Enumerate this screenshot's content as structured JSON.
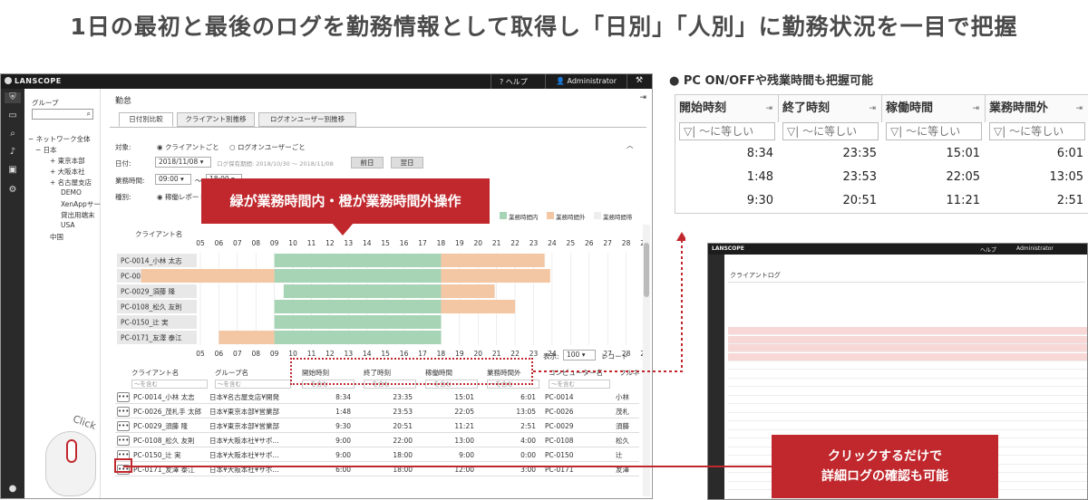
{
  "headline": "1日の最初と最後のログを勤務情報として取得し「日別」「人別」に勤務状況を一目で把握",
  "app": {
    "brand": "LANSCOPE",
    "help": "ヘルプ",
    "admin": "Administrator",
    "sidebar": {
      "group_label": "グループ",
      "tree": [
        "ネットワーク全体",
        "日本",
        "東京本部",
        "大阪本社",
        "名古屋支店",
        "DEMO",
        "XenAppサー.",
        "貸出用端末",
        "USA",
        "中国"
      ]
    },
    "page_title": "勤怠",
    "tabs": [
      "日付別比較",
      "クライアント別推移",
      "ログオンユーザー別推移"
    ],
    "form": {
      "target_label": "対象:",
      "target_opt1": "クライアントごと",
      "target_opt2": "ログオンユーザーごと",
      "date_label": "日付:",
      "date_value": "2018/11/08",
      "retention": "ログ保有期間: 2018/10/30 ～ 2018/11/08",
      "prev": "前日",
      "next": "翌日",
      "hours_label": "業務時間:",
      "hours_from": "09:00",
      "hours_to": "18:00",
      "type_label": "種別:",
      "type_opt": "稼働レポート"
    },
    "legend": [
      "業務時間内",
      "業務時間外",
      "業務時間帯"
    ],
    "chart_col_label": "クライアント名",
    "hours": [
      "05",
      "06",
      "07",
      "08",
      "09",
      "10",
      "11",
      "12",
      "13",
      "14",
      "15",
      "16",
      "17",
      "18",
      "19",
      "20",
      "21",
      "22",
      "23",
      "24",
      "25",
      "26",
      "27",
      "28",
      "29"
    ],
    "clients": [
      "PC-0014_小林 太志",
      "PC-0026_茂札手 太郎",
      "PC-0029_須藤 隆",
      "PC-0108_松久 友則",
      "PC-0150_辻 実",
      "PC-0171_友澤 泰江"
    ],
    "display_label": "表示:",
    "display_value": "100",
    "records_label": "レコード",
    "table_headers": [
      "クライアント名",
      "グループ名",
      "開始時刻",
      "終了時刻",
      "稼働時間",
      "業務時間外",
      "コンピューター名",
      "フルネ"
    ],
    "filter_placeholder": "～を含む",
    "rows": [
      [
        "PC-0014_小林 太志",
        "日本¥名古屋支店¥開発",
        "8:34",
        "23:35",
        "15:01",
        "6:01",
        "PC-0014",
        "小林"
      ],
      [
        "PC-0026_茂札手 太郎",
        "日本¥東京本部¥営業部",
        "1:48",
        "23:53",
        "22:05",
        "13:05",
        "PC-0026",
        "茂札"
      ],
      [
        "PC-0029_須藤 隆",
        "日本¥東京本部¥営業部",
        "9:30",
        "20:51",
        "11:21",
        "2:51",
        "PC-0029",
        "須藤"
      ],
      [
        "PC-0108_松久 友則",
        "日本¥大阪本社¥サポ...",
        "9:00",
        "22:00",
        "13:00",
        "4:00",
        "PC-0108",
        "松久"
      ],
      [
        "PC-0150_辻 実",
        "日本¥大阪本社¥サポ...",
        "9:00",
        "18:00",
        "9:00",
        "0:00",
        "PC-0150",
        "辻"
      ],
      [
        "PC-0171_友澤 泰江",
        "日本¥大阪本社¥サポ...",
        "6:00",
        "18:00",
        "12:00",
        "3:00",
        "PC-0171",
        "友澤"
      ]
    ]
  },
  "callout_main": "緑が業務時間内・橙が業務時間外操作",
  "callout_click": "クリックするだけで\n詳細ログの確認も可能",
  "click_text": "Click",
  "right_title": "● PC ON/OFFや残業時間も把握可能",
  "right_table": {
    "headers": [
      "開始時刻",
      "終了時刻",
      "稼働時間",
      "業務時間外"
    ],
    "filter": "～に等しい",
    "rows": [
      [
        "8:34",
        "23:35",
        "15:01",
        "6:01"
      ],
      [
        "1:48",
        "23:53",
        "22:05",
        "13:05"
      ],
      [
        "9:30",
        "20:51",
        "11:21",
        "2:51"
      ]
    ]
  },
  "mini": {
    "brand": "LANSCOPE",
    "title": "クライアントログ",
    "admin": "Administrator",
    "help": "ヘルプ"
  },
  "colors": {
    "inside": "#a6d4b4",
    "outside": "#f4c7a4",
    "accent": "#c0282d"
  },
  "chart_data": {
    "type": "bar",
    "title": "",
    "categories": [
      "PC-0014_小林 太志",
      "PC-0026_茂札手 太郎",
      "PC-0029_須藤 隆",
      "PC-0108_松久 友則",
      "PC-0150_辻 実",
      "PC-0171_友澤 泰江"
    ],
    "series": [
      {
        "name": "業務時間内",
        "ranges": [
          [
            9,
            18
          ],
          [
            9,
            18
          ],
          [
            9.5,
            18
          ],
          [
            9,
            18
          ],
          [
            9,
            18
          ],
          [
            9,
            18
          ]
        ]
      },
      {
        "name": "業務時間外",
        "ranges": [
          [
            [
              18,
              23.6
            ]
          ],
          [
            [
              1.8,
              9
            ],
            [
              18,
              23.9
            ]
          ],
          [
            [
              18,
              20.9
            ]
          ],
          [
            [
              18,
              22
            ]
          ],
          [],
          [
            [
              6,
              9
            ]
          ]
        ]
      }
    ],
    "xlim": [
      5,
      29
    ]
  }
}
